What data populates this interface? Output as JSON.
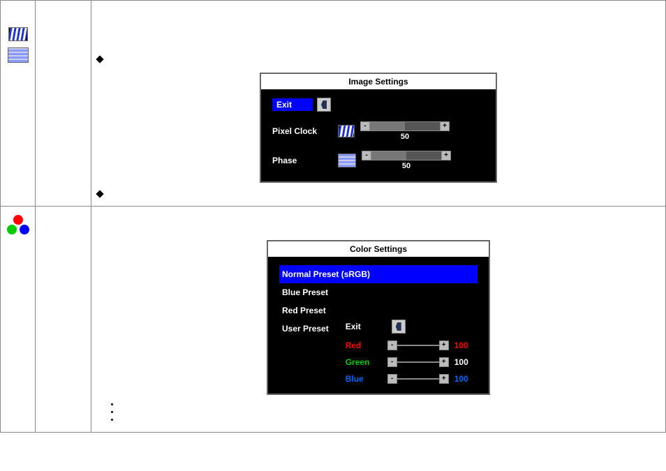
{
  "image_settings": {
    "title": "Image Settings",
    "exit_label": "Exit",
    "pixelclock_label": "Pixel Clock",
    "pixelclock_value": "50",
    "phase_label": "Phase",
    "phase_value": "50"
  },
  "color_settings": {
    "title": "Color Settings",
    "normal_preset": "Normal Preset (sRGB)",
    "blue_preset": "Blue Preset",
    "red_preset": "Red Preset",
    "user_preset": "User Preset",
    "exit_label": "Exit",
    "red_label": "Red",
    "red_value": "100",
    "green_label": "Green",
    "green_value": "100",
    "blue_label": "Blue",
    "blue_value": "100"
  }
}
